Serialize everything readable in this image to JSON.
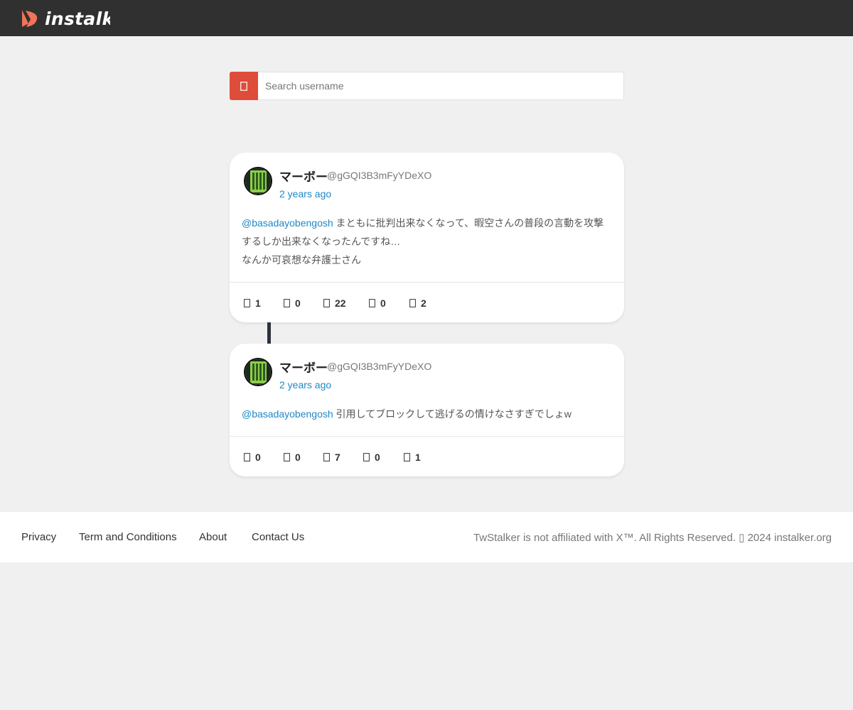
{
  "header": {
    "logo_text": "instalker",
    "logo_color": "#f0735a"
  },
  "search": {
    "placeholder": "Search username",
    "icon": "search-icon",
    "button_color": "#de4c3a"
  },
  "tweets": [
    {
      "display_name": "マーボー",
      "handle": "@gGQI3B3mFyYDeXO",
      "time": "2 years ago",
      "mention": "@basadayobengosh",
      "text_line1": " まともに批判出来なくなって、暇空さんの普段の言動を攻撃",
      "text_line2": "するしか出来なくなったんですね…",
      "text_line3": "なんか可哀想な弁護士さん",
      "stats": {
        "replies": "1",
        "retweets": "0",
        "likes": "22",
        "quotes": "0",
        "bookmarks": "2"
      }
    },
    {
      "display_name": "マーボー",
      "handle": "@gGQI3B3mFyYDeXO",
      "time": "2 years ago",
      "mention": "@basadayobengosh",
      "text_line1": " 引用してブロックして逃げるの情けなさすぎでしょw",
      "stats": {
        "replies": "0",
        "retweets": "0",
        "likes": "7",
        "quotes": "0",
        "bookmarks": "1"
      }
    }
  ],
  "footer": {
    "links": [
      "Privacy",
      "Term and Conditions",
      "About",
      "Contact Us"
    ],
    "copyright": "TwStalker is not affiliated with X™. All Rights Reserved. ▯ 2024 instalker.org"
  },
  "colors": {
    "accent_link": "#1e88c7",
    "topbar": "#303030",
    "thread_connector": "#2c333a"
  }
}
